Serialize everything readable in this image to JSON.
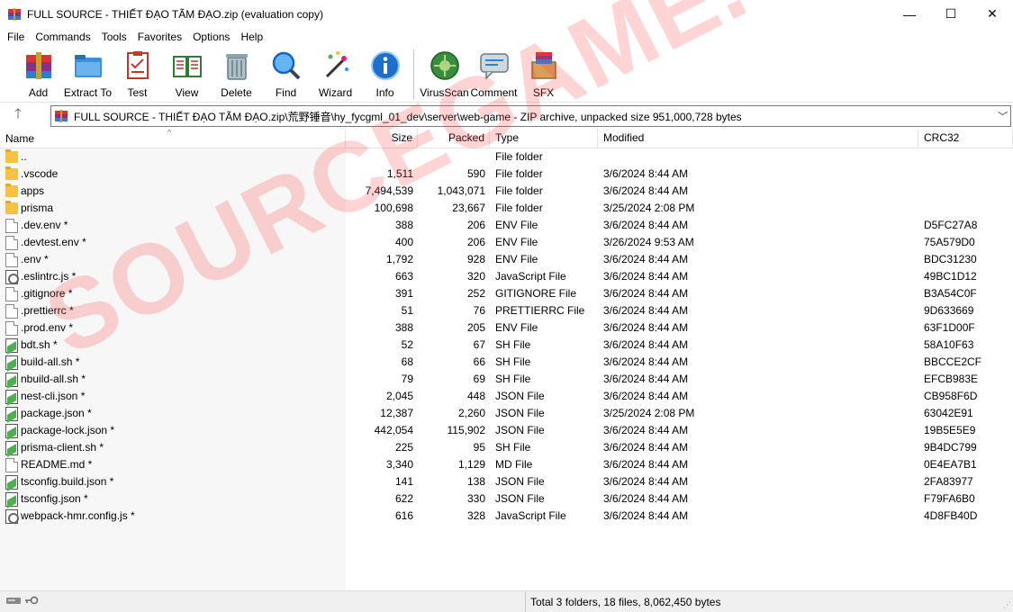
{
  "window": {
    "title": "FULL SOURCE - THIẾT ĐẠO TÃM ĐẠO.zip (evaluation copy)",
    "minimize_glyph": "—",
    "maximize_glyph": "☐",
    "close_glyph": "✕"
  },
  "menu": [
    "File",
    "Commands",
    "Tools",
    "Favorites",
    "Options",
    "Help"
  ],
  "toolbar": {
    "add": "Add",
    "extract_to": "Extract To",
    "test": "Test",
    "view": "View",
    "delete": "Delete",
    "find": "Find",
    "wizard": "Wizard",
    "info": "Info",
    "virusscan": "VirusScan",
    "comment": "Comment",
    "sfx": "SFX"
  },
  "address": {
    "path": "FULL SOURCE - THIẾT ĐẠO TÃM ĐẠO.zip\\荒野锤音\\hy_fycgml_01_dev\\server\\web-game - ZIP archive, unpacked size 951,000,728 bytes"
  },
  "columns": {
    "name": "Name",
    "size": "Size",
    "packed": "Packed",
    "type": "Type",
    "modified": "Modified",
    "crc": "CRC32"
  },
  "files": [
    {
      "name": "..",
      "size": "",
      "packed": "",
      "type": "File folder",
      "modified": "",
      "crc": "",
      "icon": "folder"
    },
    {
      "name": ".vscode",
      "size": "1,511",
      "packed": "590",
      "type": "File folder",
      "modified": "3/6/2024 8:44 AM",
      "crc": "",
      "icon": "folder"
    },
    {
      "name": "apps",
      "size": "7,494,539",
      "packed": "1,043,071",
      "type": "File folder",
      "modified": "3/6/2024 8:44 AM",
      "crc": "",
      "icon": "folder"
    },
    {
      "name": "prisma",
      "size": "100,698",
      "packed": "23,667",
      "type": "File folder",
      "modified": "3/25/2024 2:08 PM",
      "crc": "",
      "icon": "folder"
    },
    {
      "name": ".dev.env *",
      "size": "388",
      "packed": "206",
      "type": "ENV File",
      "modified": "3/6/2024 8:44 AM",
      "crc": "D5FC27A8",
      "icon": "doc"
    },
    {
      "name": ".devtest.env *",
      "size": "400",
      "packed": "206",
      "type": "ENV File",
      "modified": "3/26/2024 9:53 AM",
      "crc": "75A579D0",
      "icon": "doc"
    },
    {
      "name": ".env *",
      "size": "1,792",
      "packed": "928",
      "type": "ENV File",
      "modified": "3/6/2024 8:44 AM",
      "crc": "BDC31230",
      "icon": "doc"
    },
    {
      "name": ".eslintrc.js *",
      "size": "663",
      "packed": "320",
      "type": "JavaScript File",
      "modified": "3/6/2024 8:44 AM",
      "crc": "49BC1D12",
      "icon": "script"
    },
    {
      "name": ".gitignore *",
      "size": "391",
      "packed": "252",
      "type": "GITIGNORE File",
      "modified": "3/6/2024 8:44 AM",
      "crc": "B3A54C0F",
      "icon": "doc"
    },
    {
      "name": ".prettierrc *",
      "size": "51",
      "packed": "76",
      "type": "PRETTIERRC File",
      "modified": "3/6/2024 8:44 AM",
      "crc": "9D633669",
      "icon": "doc"
    },
    {
      "name": ".prod.env *",
      "size": "388",
      "packed": "205",
      "type": "ENV File",
      "modified": "3/6/2024 8:44 AM",
      "crc": "63F1D00F",
      "icon": "doc"
    },
    {
      "name": "bdt.sh *",
      "size": "52",
      "packed": "67",
      "type": "SH File",
      "modified": "3/6/2024 8:44 AM",
      "crc": "58A10F63",
      "icon": "green"
    },
    {
      "name": "build-all.sh *",
      "size": "68",
      "packed": "66",
      "type": "SH File",
      "modified": "3/6/2024 8:44 AM",
      "crc": "BBCCE2CF",
      "icon": "green"
    },
    {
      "name": "nbuild-all.sh *",
      "size": "79",
      "packed": "69",
      "type": "SH File",
      "modified": "3/6/2024 8:44 AM",
      "crc": "EFCB983E",
      "icon": "green"
    },
    {
      "name": "nest-cli.json *",
      "size": "2,045",
      "packed": "448",
      "type": "JSON File",
      "modified": "3/6/2024 8:44 AM",
      "crc": "CB958F6D",
      "icon": "green"
    },
    {
      "name": "package.json *",
      "size": "12,387",
      "packed": "2,260",
      "type": "JSON File",
      "modified": "3/25/2024 2:08 PM",
      "crc": "63042E91",
      "icon": "green"
    },
    {
      "name": "package-lock.json *",
      "size": "442,054",
      "packed": "115,902",
      "type": "JSON File",
      "modified": "3/6/2024 8:44 AM",
      "crc": "19B5E5E9",
      "icon": "green"
    },
    {
      "name": "prisma-client.sh *",
      "size": "225",
      "packed": "95",
      "type": "SH File",
      "modified": "3/6/2024 8:44 AM",
      "crc": "9B4DC799",
      "icon": "green"
    },
    {
      "name": "README.md *",
      "size": "3,340",
      "packed": "1,129",
      "type": "MD File",
      "modified": "3/6/2024 8:44 AM",
      "crc": "0E4EA7B1",
      "icon": "doc"
    },
    {
      "name": "tsconfig.build.json *",
      "size": "141",
      "packed": "138",
      "type": "JSON File",
      "modified": "3/6/2024 8:44 AM",
      "crc": "2FA83977",
      "icon": "green"
    },
    {
      "name": "tsconfig.json *",
      "size": "622",
      "packed": "330",
      "type": "JSON File",
      "modified": "3/6/2024 8:44 AM",
      "crc": "F79FA6B0",
      "icon": "green"
    },
    {
      "name": "webpack-hmr.config.js *",
      "size": "616",
      "packed": "328",
      "type": "JavaScript File",
      "modified": "3/6/2024 8:44 AM",
      "crc": "4D8FB40D",
      "icon": "script"
    }
  ],
  "status": {
    "summary": "Total 3 folders, 18 files, 8,062,450 bytes"
  },
  "watermark": "SOURCEGAME.VN"
}
